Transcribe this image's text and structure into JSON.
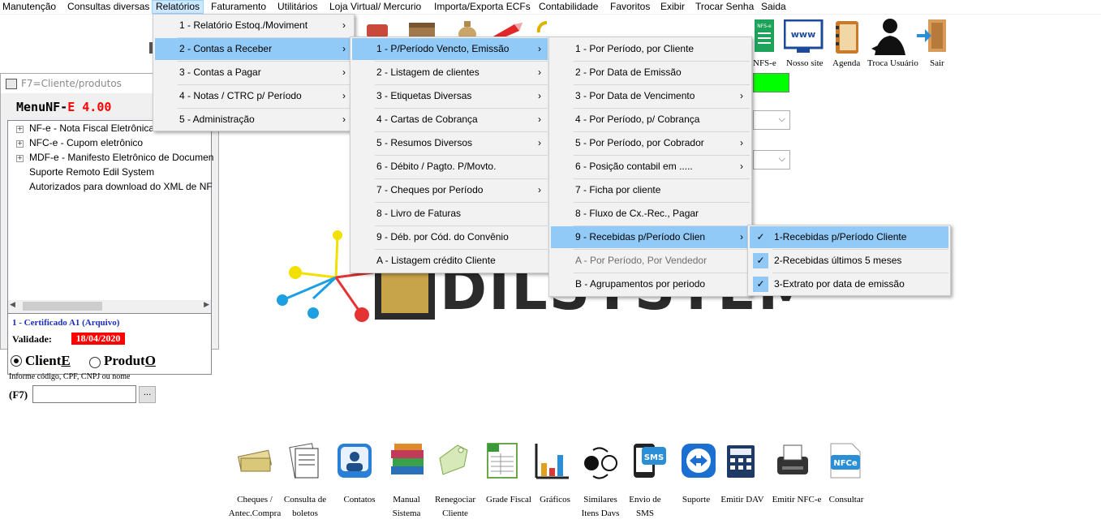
{
  "menubar": {
    "items": [
      "Manutenção",
      "Consultas diversas",
      "Relatórios",
      "Faturamento",
      "Utilitários",
      "Loja Virtual/ Mercurio",
      "Importa/Exporta ECFs",
      "Contabilidade",
      "Favoritos",
      "Exibir",
      "Trocar Senha",
      "Saida"
    ]
  },
  "toolbar": {
    "labels": [
      "NFS-e",
      "Nosso site",
      "Agenda",
      "Troca Usuário",
      "Sair"
    ],
    "site_icon_text": "www"
  },
  "menu1": {
    "items": [
      "1 - Relatório Estoq./Moviment",
      "2 - Contas a Receber",
      "3 - Contas a Pagar",
      "4 - Notas / CTRC p/ Período",
      "5 - Administração"
    ]
  },
  "menu2": {
    "items": [
      "1 - P/Período Vencto, Emissão",
      "2 - Listagem de clientes",
      "3 - Etiquetas Diversas",
      "4 - Cartas de Cobrança",
      "5 - Resumos Diversos",
      "6 - Débito / Pagto. P/Movto.",
      "7 - Cheques por Período",
      "8 - Livro de Faturas",
      "9 - Déb. por Cód. do Convênio",
      "A - Listagem crédito Cliente"
    ]
  },
  "menu3": {
    "items": [
      "1 - Por Período, por Cliente",
      "2 - Por Data de Emissão",
      "3 - Por Data de Vencimento",
      "4 - Por Período, p/ Cobrança",
      "5 - Por Período, por Cobrador",
      "6 - Posição contabil em .....",
      "7 - Ficha por cliente",
      "8 - Fluxo de Cx.-Rec., Pagar",
      "9 - Recebidas p/Período Clien",
      "A - Por Período, Por Vendedor",
      "B - Agrupamentos por periodo"
    ]
  },
  "menu4": {
    "items": [
      "1-Recebidas p/Período Cliente",
      "2-Recebidas últimos 5 meses",
      "3-Extrato por data de emissão"
    ]
  },
  "panel": {
    "title": "F7=Cliente/produtos",
    "brand_a": "MenuNF-",
    "brand_b": "E 4.00",
    "tree": [
      "NF-e - Nota Fiscal Eletrônica",
      "NFC-e - Cupom eletrônico",
      "MDF-e - Manifesto Eletrônico de Documen",
      "Suporte Remoto Edil System",
      "Autorizados para download do XML de NF"
    ],
    "cert": "1 - Certificado A1 (Arquivo)",
    "validity_label": "Validade:",
    "validity_date": "18/04/2020"
  },
  "search": {
    "opt_client_a": "Client",
    "opt_client_b": "E",
    "opt_product_a": "Produt",
    "opt_product_b": "O",
    "hint": "Informe código, CPF, CNPJ ou nome",
    "f7": "(F7)",
    "browse": "..."
  },
  "logo": {
    "text": "DILSYSTEM"
  },
  "bottom": {
    "items": [
      {
        "l1": "Cheques /",
        "l2": "Antec.Compra"
      },
      {
        "l1": "Consulta de",
        "l2": "boletos"
      },
      {
        "l1": "Contatos",
        "l2": ""
      },
      {
        "l1": "Manual",
        "l2": "Sistema"
      },
      {
        "l1": "Renegociar",
        "l2": "Cliente"
      },
      {
        "l1": "Grade Fiscal",
        "l2": ""
      },
      {
        "l1": "Gráficos",
        "l2": ""
      },
      {
        "l1": "Similares",
        "l2": "Itens Davs"
      },
      {
        "l1": "Envio de",
        "l2": "SMS"
      },
      {
        "l1": "Suporte",
        "l2": ""
      },
      {
        "l1": "Emitir DAV",
        "l2": ""
      },
      {
        "l1": "Emitir NFC-e",
        "l2": ""
      },
      {
        "l1": "Consultar",
        "l2": ""
      }
    ],
    "sms_text": "SMS",
    "nfce_text": "NFCe"
  },
  "colors": {
    "menu_highlight": "#91c9f7",
    "green_box": "#00ff00",
    "validity_bg": "#ff0000",
    "brand_red": "#ff0000"
  }
}
